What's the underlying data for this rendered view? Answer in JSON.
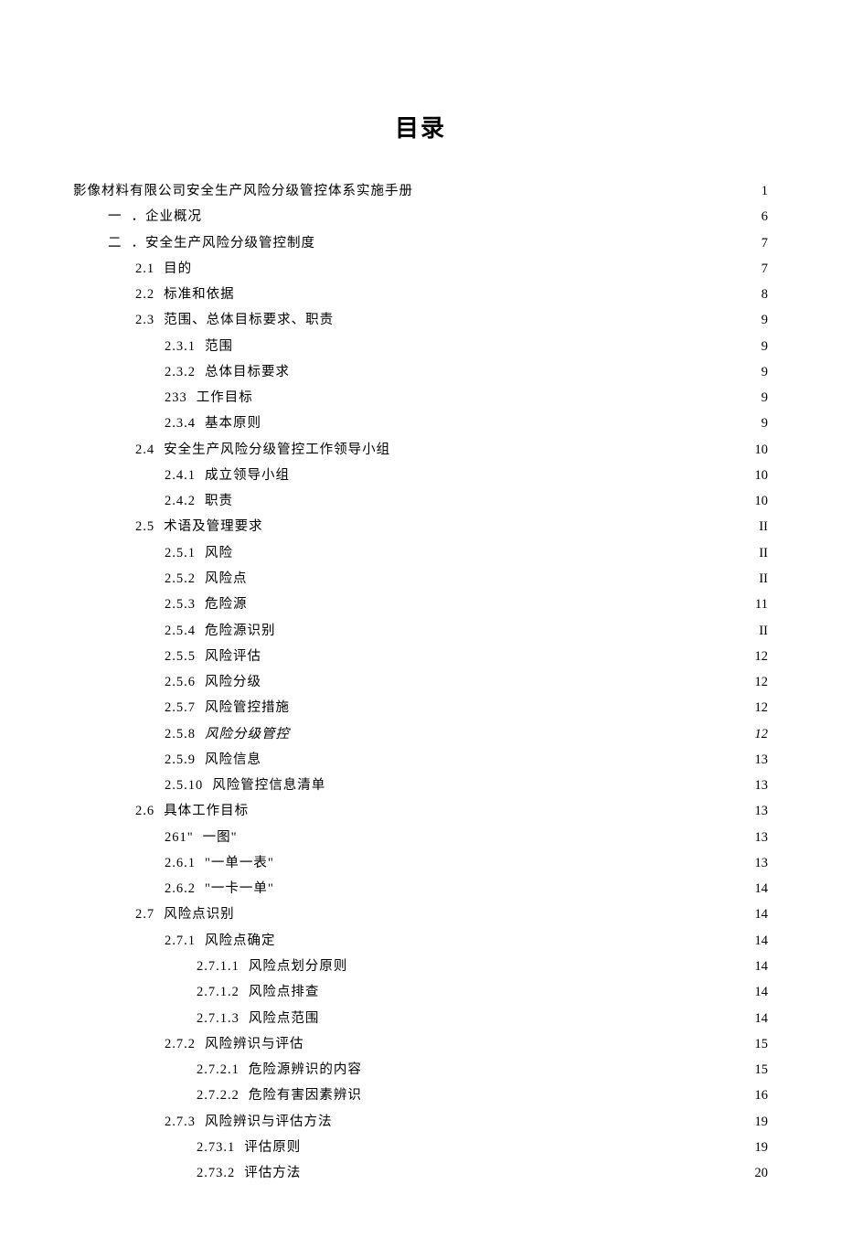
{
  "title": "目录",
  "entries": [
    {
      "indent": 0,
      "num": "",
      "text": "影像材料有限公司安全生产风险分级管控体系实施手册",
      "page": "1"
    },
    {
      "indent": 1,
      "num": "一",
      "text": "．企业概况",
      "page": "6"
    },
    {
      "indent": 1,
      "num": "二",
      "text": "．安全生产风险分级管控制度",
      "page": "7"
    },
    {
      "indent": 2,
      "num": "2.1",
      "text": "目的",
      "page": "7"
    },
    {
      "indent": 2,
      "num": "2.2",
      "text": "标准和依据",
      "page": "8"
    },
    {
      "indent": 2,
      "num": "2.3",
      "text": "范围、总体目标要求、职责",
      "page": "9"
    },
    {
      "indent": 3,
      "num": "2.3.1",
      "text": "范围",
      "page": "9"
    },
    {
      "indent": 3,
      "num": "2.3.2",
      "text": "总体目标要求",
      "page": "9"
    },
    {
      "indent": 3,
      "num": "233",
      "text": "工作目标",
      "page": "9"
    },
    {
      "indent": 3,
      "num": "2.3.4",
      "text": "基本原则",
      "page": "9"
    },
    {
      "indent": 2,
      "num": "2.4",
      "text": "安全生产风险分级管控工作领导小组",
      "page": "10"
    },
    {
      "indent": 3,
      "num": "2.4.1",
      "text": "成立领导小组",
      "page": "10"
    },
    {
      "indent": 3,
      "num": "2.4.2",
      "text": "职责",
      "page": "10"
    },
    {
      "indent": 2,
      "num": "2.5",
      "text": "术语及管理要求",
      "page": "II"
    },
    {
      "indent": 3,
      "num": "2.5.1",
      "text": "风险",
      "page": "II"
    },
    {
      "indent": 3,
      "num": "2.5.2",
      "text": "风险点",
      "page": "II"
    },
    {
      "indent": 3,
      "num": "2.5.3",
      "text": "危险源",
      "page": "11"
    },
    {
      "indent": 3,
      "num": "2.5.4",
      "text": "危险源识别",
      "page": "II"
    },
    {
      "indent": 3,
      "num": "2.5.5",
      "text": "风险评估",
      "page": "12"
    },
    {
      "indent": 3,
      "num": "2.5.6",
      "text": "风险分级",
      "page": "12"
    },
    {
      "indent": 3,
      "num": "2.5.7",
      "text": "风险管控措施",
      "page": "12"
    },
    {
      "indent": 3,
      "num": "2.5.8",
      "text": "风险分级管控",
      "page": "12",
      "italic": true
    },
    {
      "indent": 3,
      "num": "2.5.9",
      "text": "风险信息",
      "page": "13"
    },
    {
      "indent": 3,
      "num": "2.5.10",
      "text": "风险管控信息清单",
      "page": "13"
    },
    {
      "indent": 2,
      "num": "2.6",
      "text": "具体工作目标",
      "page": "13"
    },
    {
      "indent": 3,
      "num": "261\"",
      "text": "一图\"",
      "page": "13"
    },
    {
      "indent": 3,
      "num": "2.6.1",
      "text": "\"一单一表\"",
      "page": "13"
    },
    {
      "indent": 3,
      "num": "2.6.2",
      "text": "\"一卡一单\"",
      "page": "14"
    },
    {
      "indent": 2,
      "num": "2.7",
      "text": "风险点识别",
      "page": "14"
    },
    {
      "indent": 3,
      "num": "2.7.1",
      "text": "风险点确定",
      "page": "14"
    },
    {
      "indent": 4,
      "num": "2.7.1.1",
      "text": "风险点划分原则",
      "page": "14"
    },
    {
      "indent": 4,
      "num": "2.7.1.2",
      "text": "风险点排查",
      "page": "14"
    },
    {
      "indent": 4,
      "num": "2.7.1.3",
      "text": "风险点范围",
      "page": "14"
    },
    {
      "indent": 3,
      "num": "2.7.2",
      "text": "风险辨识与评估",
      "page": "15"
    },
    {
      "indent": 4,
      "num": "2.7.2.1",
      "text": "危险源辨识的内容",
      "page": "15"
    },
    {
      "indent": 4,
      "num": "2.7.2.2",
      "text": "危险有害因素辨识",
      "page": "16"
    },
    {
      "indent": 3,
      "num": "2.7.3",
      "text": "风险辨识与评估方法",
      "page": "19"
    },
    {
      "indent": 4,
      "num": "2.73.1",
      "text": "评估原则",
      "page": "19"
    },
    {
      "indent": 4,
      "num": "2.73.2",
      "text": "评估方法",
      "page": "20"
    }
  ]
}
